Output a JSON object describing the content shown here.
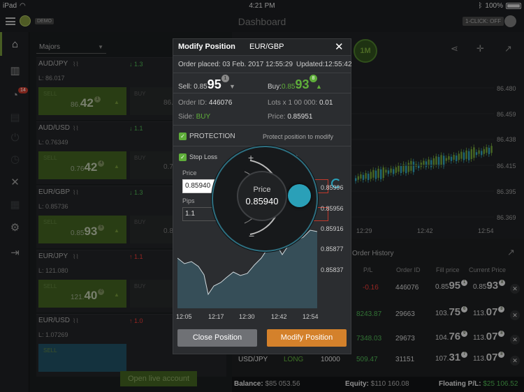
{
  "status": {
    "device": "iPad",
    "time": "4:21 PM",
    "battery": "100%"
  },
  "header": {
    "demo": "DEMO",
    "title": "Dashboard",
    "one_click": "1-CLICK: OFF"
  },
  "sidebar": {
    "notifications": "14"
  },
  "instruments": {
    "filter": "Majors",
    "items": [
      {
        "pair": "AUD/JPY",
        "change": "1.3",
        "dir": "up",
        "low": "L: 86.017",
        "sell_label": "SELL",
        "sell_main": "86.",
        "sell_big": "42",
        "sell_pip": "1",
        "buy_label": "BUY",
        "buy_partial": "86."
      },
      {
        "pair": "AUD/USD",
        "change": "1.1",
        "dir": "up",
        "low": "L: 0.76349",
        "sell_label": "SELL",
        "sell_main": "0.76",
        "sell_big": "42",
        "sell_pip": "4",
        "buy_label": "BUY",
        "buy_partial": "0.76"
      },
      {
        "pair": "EUR/GBP",
        "change": "1.3",
        "dir": "up",
        "low": "L: 0.85736",
        "sell_label": "SELL",
        "sell_main": "0.85",
        "sell_big": "93",
        "sell_pip": "5",
        "buy_label": "BUY",
        "buy_partial": "0.85"
      },
      {
        "pair": "EUR/JPY",
        "change": "1.1",
        "dir": "down",
        "low": "L: 121.080",
        "sell_label": "SELL",
        "sell_main": "121.",
        "sell_big": "40",
        "sell_pip": "0",
        "buy_label": "BUY",
        "buy_partial": ""
      },
      {
        "pair": "EUR/USD",
        "change": "1.0",
        "dir": "down",
        "low": "L: 1.07269",
        "sell_label": "SELL",
        "sell_main": "",
        "sell_big": "",
        "sell_pip": "",
        "buy_label": "",
        "buy_partial": ""
      }
    ],
    "open_live": "Open live account"
  },
  "chart": {
    "timeframe": "1M",
    "price_labels": [
      "86.480",
      "86.459",
      "86.438",
      "86.415",
      "86.395",
      "86.369",
      "86.369"
    ],
    "time_labels": [
      "12:29",
      "12:42",
      "12:54"
    ]
  },
  "positions": {
    "tab": "Order History",
    "headers": [
      "P/L",
      "Order ID",
      "Fill price",
      "Current Price"
    ],
    "rows": [
      {
        "pl": "-0.16",
        "pl_dir": "down",
        "order_id": "446076",
        "fill_main": "0.85",
        "fill_big": "95",
        "fill_pip": "1",
        "cur_main": "0.85",
        "cur_big": "93",
        "cur_pip": "8",
        "symbol": "",
        "side": "",
        "amount": ""
      },
      {
        "pl": "8243.87",
        "pl_dir": "up",
        "order_id": "29663",
        "fill_main": "103.",
        "fill_big": "75",
        "fill_pip": "6",
        "cur_main": "113.",
        "cur_big": "07",
        "cur_pip": "8",
        "symbol": "",
        "side": "",
        "amount": ""
      },
      {
        "pl": "7348.03",
        "pl_dir": "up",
        "order_id": "29673",
        "fill_main": "104.",
        "fill_big": "76",
        "fill_pip": "9",
        "cur_main": "113.",
        "cur_big": "07",
        "cur_pip": "8",
        "symbol": "",
        "side": "",
        "amount": ""
      },
      {
        "pl": "509.47",
        "pl_dir": "up",
        "order_id": "31151",
        "fill_main": "107.",
        "fill_big": "31",
        "fill_pip": "7",
        "cur_main": "113.",
        "cur_big": "07",
        "cur_pip": "8",
        "symbol": "USD/JPY",
        "side": "LONG",
        "amount": "10000"
      }
    ],
    "balance_label": "Balance:",
    "balance": "$85 053.56",
    "equity_label": "Equity:",
    "equity": "$110 160.08",
    "floating_label": "Floating P/L:",
    "floating": "$25 106.52"
  },
  "modal": {
    "title": "Modify Position",
    "pair": "EUR/GBP",
    "placed_label": "Order placed:",
    "placed": "03 Feb. 2017 12:55:29",
    "updated_label": "Updated:",
    "updated": "12:55:42",
    "sell_label": "Sell:",
    "sell_main": "0.85",
    "sell_big": "95",
    "sell_pip": "1",
    "buy_label": "Buy:",
    "buy_main": "0.85",
    "buy_big": "93",
    "buy_pip": "8",
    "order_id_label": "Order ID:",
    "order_id": "446076",
    "lots_label": "Lots x 1 00 000:",
    "lots": "0.01",
    "side_label": "Side:",
    "side": "BUY",
    "price_label": "Price:",
    "price": "0.85951",
    "protection": "PROTECTION",
    "protect_hint": "Protect position to modify",
    "stop_loss": "Stop Loss",
    "take_profit": "ofit",
    "field_price_label": "Price",
    "field_price": "0.85940",
    "field_pips_label": "Pips",
    "field_pips": "1.1",
    "close_btn": "Close Position",
    "modify_btn": "Modify Position",
    "dial": {
      "label": "Price",
      "value": "0.85940",
      "plus": "+",
      "minus": "−"
    },
    "mini_chart": {
      "y_labels": [
        "0.85996",
        "0.85956",
        "0.85916",
        "0.85877",
        "0.85837"
      ],
      "x_labels": [
        "12:05",
        "12:17",
        "12:30",
        "12:42",
        "12:54"
      ]
    }
  }
}
